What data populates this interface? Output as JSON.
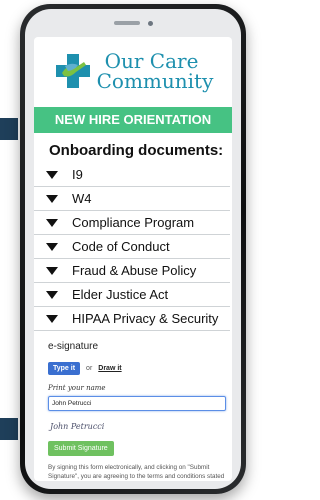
{
  "logo": {
    "line1": "Our Care",
    "line2": "Community"
  },
  "banner": {
    "text": "NEW HIRE ORIENTATION"
  },
  "onboarding": {
    "title": "Onboarding documents:",
    "items": [
      {
        "label": "I9"
      },
      {
        "label": "W4"
      },
      {
        "label": "Compliance Program"
      },
      {
        "label": "Code of Conduct"
      },
      {
        "label": "Fraud & Abuse Policy"
      },
      {
        "label": "Elder Justice Act"
      },
      {
        "label": "HIPAA Privacy & Security"
      }
    ]
  },
  "esignature": {
    "label": "e-signature",
    "type_button": "Type it",
    "or_text": "or",
    "draw_link": "Draw it",
    "print_label": "Print your name",
    "name_value": "John Petrucci",
    "signature_preview": "John Petrucci",
    "submit_label": "Submit Signature",
    "legal_text": "By signing this form electronically, and clicking on \"Submit Signature\", you are agreeing to the terms and conditions stated herein."
  },
  "colors": {
    "brand": "#1e90ae",
    "banner": "#46c283",
    "type_button": "#3a6fd0",
    "submit_button": "#6fc160"
  }
}
